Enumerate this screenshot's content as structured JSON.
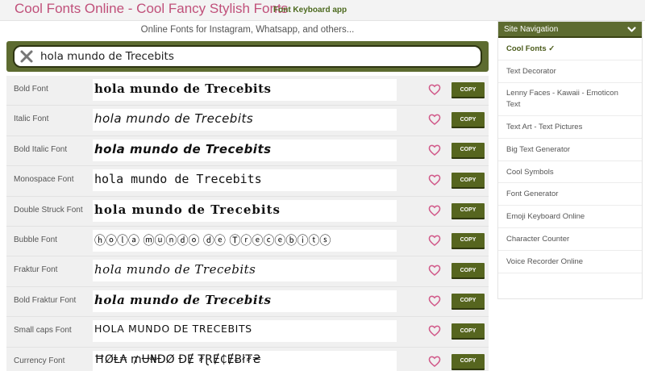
{
  "header": {
    "title": "Cool Fonts Online - Cool Fancy Stylish Fonts",
    "subtitle": "Font Keyboard app"
  },
  "tagline": "Online Fonts for Instagram, Whatsapp, and others...",
  "search": {
    "value": "hola mundo de Trecebits",
    "clear_icon": "close-icon"
  },
  "copy_label": "COPY",
  "rows": [
    {
      "label": "Bold Font",
      "text": "hola mundo de Trecebits"
    },
    {
      "label": "Italic Font",
      "text": "hola mundo de Trecebits"
    },
    {
      "label": "Bold Italic Font",
      "text": "hola mundo de Trecebits"
    },
    {
      "label": "Monospace Font",
      "text": "hola mundo de Trecebits"
    },
    {
      "label": "Double Struck Font",
      "text": "hola mundo de Trecebits"
    },
    {
      "label": "Bubble Font",
      "text": "ⓗⓞⓛⓐ ⓜⓤⓝⓓⓞ ⓓⓔ Ⓣⓡⓔⓒⓔⓑⓘⓣⓢ"
    },
    {
      "label": "Fraktur Font",
      "text": "hola mundo de Trecebits"
    },
    {
      "label": "Bold Fraktur Font",
      "text": "hola mundo de Trecebits"
    },
    {
      "label": "Small caps Font",
      "text": "HOLA MUNDO DE TRECEBITS"
    },
    {
      "label": "Currency Font",
      "text": "ĦØⱠ₳ ₥Ʉ₦ĐØ ĐɆ ₮ⱤɆ₵ɆɃł₮₴"
    }
  ],
  "sidebar": {
    "title": "Site Navigation",
    "items": [
      {
        "label": "Cool Fonts ✓"
      },
      {
        "label": "Text Decorator"
      },
      {
        "label": "Lenny Faces - Kawaii - Emoticon Text"
      },
      {
        "label": "Text Art - Text Pictures"
      },
      {
        "label": "Big Text Generator"
      },
      {
        "label": "Cool Symbols"
      },
      {
        "label": "Font Generator"
      },
      {
        "label": "Emoji Keyboard Online"
      },
      {
        "label": "Character Counter"
      },
      {
        "label": "Voice Recorder Online"
      }
    ]
  },
  "colors": {
    "brand_pink": "#c0507a",
    "olive": "#5d6b30",
    "heart": "#d15a8a"
  }
}
